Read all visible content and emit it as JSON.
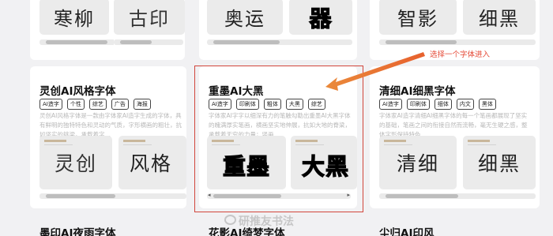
{
  "annotation": "选择一个字体进入",
  "watermark": "研推友书法",
  "top_row": [
    {
      "glyphs_a": "寒柳",
      "glyphs_b": ""
    },
    {
      "glyphs_a": "古印",
      "glyphs_b": ""
    },
    {
      "glyphs_a": "奥运",
      "glyphs_b": "器"
    },
    {
      "glyphs_a": "智影",
      "glyphs_b": "细黑"
    }
  ],
  "cards": [
    {
      "title": "灵创AI风格字体",
      "tags": [
        "AI造字",
        "个性",
        "综艺",
        "广告",
        "海报"
      ],
      "desc": "灵创AI风格字体是一款由字体家AI造字生成的字体，具有鲜明的独特特色和灵动的气质，字形横画的粗壮，抗如坚实的挑梁，承载着字…",
      "preview_a": "灵创",
      "preview_b": "风格"
    },
    {
      "title": "重墨AI大黑",
      "tags": [
        "AI造字",
        "印刷体",
        "粗体",
        "大黑",
        "综艺"
      ],
      "desc": "字体家AI字字以细深有力的笔触勾勒出重墨AI大黑字体的魄满厚实笔画，横画坚实地伸展，抗如大地的脊梁，承载着无穷的力量；竖画…",
      "preview_a": "重墨",
      "preview_b": "大黑"
    },
    {
      "title": "清细AI细黑字体",
      "tags": [
        "AI造字",
        "印刷体",
        "细体",
        "内文",
        "黑体"
      ],
      "desc": "字体家AI造字清细AI细黑字体的每一个笔画都展现了坚实的基础，笔画之间的衔接自然而流畅，毫无生硬之感，整体字形保持特色…",
      "preview_a": "清细",
      "preview_b": "细黑"
    }
  ],
  "bottom_titles": [
    "墨印AI夜雨字体",
    "花影AI绮梦字体",
    "尘归AI印风"
  ]
}
